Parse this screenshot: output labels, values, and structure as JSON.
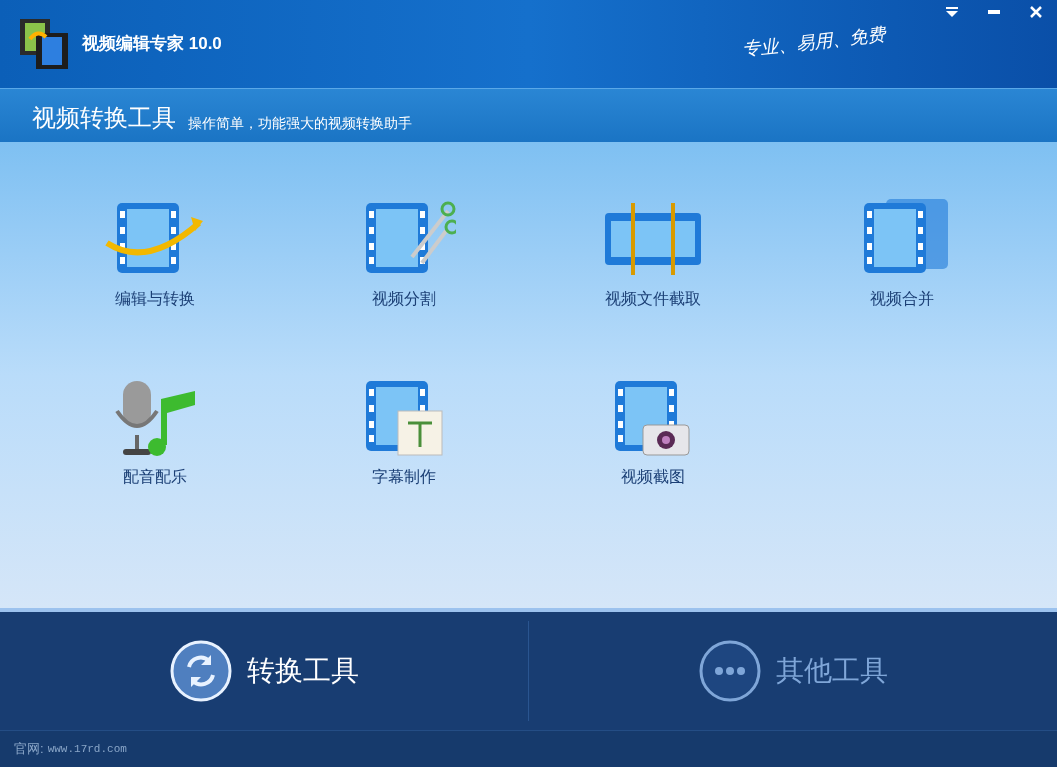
{
  "window": {
    "title": "视频编辑专家 10.0",
    "slogan": "专业、易用、免费"
  },
  "header": {
    "title": "视频转换工具",
    "subtitle": "操作简单，功能强大的视频转换助手"
  },
  "tools": [
    {
      "label": "编辑与转换",
      "kind": "convert"
    },
    {
      "label": "视频分割",
      "kind": "split"
    },
    {
      "label": "视频文件截取",
      "kind": "trim"
    },
    {
      "label": "视频合并",
      "kind": "merge"
    },
    {
      "label": "配音配乐",
      "kind": "audio"
    },
    {
      "label": "字幕制作",
      "kind": "subtitle"
    },
    {
      "label": "视频截图",
      "kind": "snapshot"
    }
  ],
  "bottom_tabs": [
    {
      "label": "转换工具",
      "kind": "convert",
      "selected": true
    },
    {
      "label": "其他工具",
      "kind": "other",
      "selected": false
    }
  ],
  "footer": {
    "label": "官网:",
    "url": "www.17rd.com"
  }
}
